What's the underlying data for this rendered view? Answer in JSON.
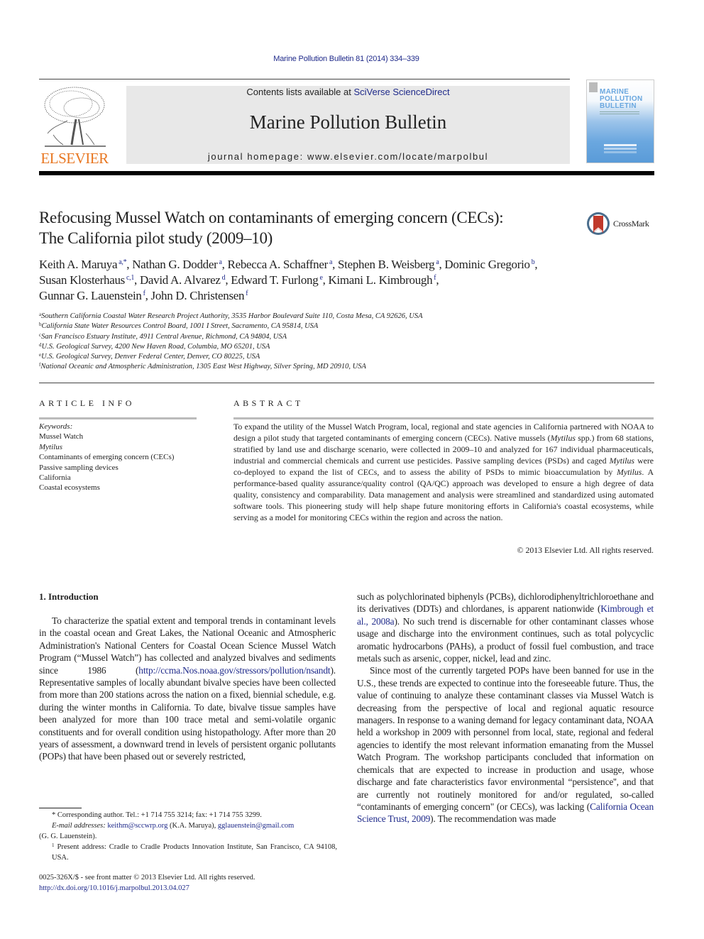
{
  "header": {
    "citation": "Marine Pollution Bulletin 81 (2014) 334–339",
    "contents_prefix": "Contents lists available at ",
    "contents_link": "SciVerse ScienceDirect",
    "journal_title": "Marine Pollution Bulletin",
    "homepage": "journal homepage: www.elsevier.com/locate/marpolbul",
    "publisher_logo_text": "ELSEVIER",
    "cover": {
      "title_lines": [
        "MARINE",
        "POLLUTION",
        "BULLETIN"
      ]
    },
    "crossmark_label": "CrossMark"
  },
  "article": {
    "title_line1": "Refocusing Mussel Watch on contaminants of emerging concern (CECs):",
    "title_line2": "The California pilot study (2009–10)",
    "authors": [
      {
        "name": "Keith A. Maruya",
        "sup": "a,*",
        "sep": ", "
      },
      {
        "name": "Nathan G. Dodder",
        "sup": "a",
        "sep": ", "
      },
      {
        "name": "Rebecca A. Schaffner",
        "sup": "a",
        "sep": ", "
      },
      {
        "name": "Stephen B. Weisberg",
        "sup": "a",
        "sep": ", "
      },
      {
        "name": "Dominic Gregorio",
        "sup": "b",
        "sep": ","
      },
      {
        "name": "Susan Klosterhaus",
        "sup": "c,1",
        "sep": ", "
      },
      {
        "name": "David A. Alvarez",
        "sup": "d",
        "sep": ", "
      },
      {
        "name": "Edward T. Furlong",
        "sup": "e",
        "sep": ", "
      },
      {
        "name": "Kimani L. Kimbrough",
        "sup": "f",
        "sep": ","
      },
      {
        "name": "Gunnar G. Lauenstein",
        "sup": "f",
        "sep": ", "
      },
      {
        "name": "John D. Christensen",
        "sup": "f",
        "sep": ""
      }
    ],
    "affiliations": [
      {
        "key": "a",
        "text": "Southern California Coastal Water Research Project Authority, 3535 Harbor Boulevard Suite 110, Costa Mesa, CA 92626, USA"
      },
      {
        "key": "b",
        "text": "California State Water Resources Control Board, 1001 I Street, Sacramento, CA 95814, USA"
      },
      {
        "key": "c",
        "text": "San Francisco Estuary Institute, 4911 Central Avenue, Richmond, CA 94804, USA"
      },
      {
        "key": "d",
        "text": "U.S. Geological Survey, 4200 New Haven Road, Columbia, MO 65201, USA"
      },
      {
        "key": "e",
        "text": "U.S. Geological Survey, Denver Federal Center, Denver, CO 80225, USA"
      },
      {
        "key": "f",
        "text": "National Oceanic and Atmospheric Administration, 1305 East West Highway, Silver Spring, MD 20910, USA"
      }
    ]
  },
  "article_info": {
    "heading": "ARTICLE INFO",
    "keywords_label": "Keywords:",
    "keywords": [
      "Mussel Watch",
      "Mytilus",
      "Contaminants of emerging concern (CECs)",
      "Passive sampling devices",
      "California",
      "Coastal ecosystems"
    ]
  },
  "abstract": {
    "heading": "ABSTRACT",
    "p1": "To expand the utility of the Mussel Watch Program, local, regional and state agencies in California partnered with NOAA to design a pilot study that targeted contaminants of emerging concern (CECs). Native mussels (",
    "p1_italic": "Mytilus",
    "p2": " spp.) from 68 stations, stratified by land use and discharge scenario, were collected in 2009–10 and analyzed for 167 individual pharmaceuticals, industrial and commercial chemicals and current use pesticides. Passive sampling devices (PSDs) and caged ",
    "p2_italic": "Mytilus",
    "p3": " were co-deployed to expand the list of CECs, and to assess the ability of PSDs to mimic bioaccumulation by ",
    "p3_italic": "Mytilus",
    "p4": ". A performance-based quality assurance/quality control (QA/QC) approach was developed to ensure a high degree of data quality, consistency and comparability. Data management and analysis were streamlined and standardized using automated software tools. This pioneering study will help shape future monitoring efforts in California's coastal ecosystems, while serving as a model for monitoring CECs within the region and across the nation.",
    "copyright": "© 2013 Elsevier Ltd. All rights reserved."
  },
  "introduction": {
    "heading": "1. Introduction",
    "left_p1_a": "To characterize the spatial extent and temporal trends in contaminant levels in the coastal ocean and Great Lakes, the National Oceanic and Atmospheric Administration's National Centers for Coastal Ocean Science Mussel Watch Program (“Mussel Watch”) has collected and analyzed bivalves and sediments since 1986 (",
    "left_p1_link": "http://ccma.Nos.noaa.gov/stressors/pollution/nsandt",
    "left_p1_b": ").  Representative samples of locally abundant bivalve species have been collected from more than 200 stations across the nation on a fixed, biennial schedule, e.g. during the winter months in California. To date, bivalve tissue samples have been analyzed for more than 100 trace metal and semi-volatile organic constituents and for overall condition using histopathology. After more than 20 years of assessment, a downward trend in levels of persistent organic pollutants (POPs) that have been phased out or severely restricted,",
    "right_p1_a": "such as polychlorinated biphenyls (PCBs), dichlorodiphenyltrichloroethane and its derivatives (DDTs) and chlordanes, is apparent nationwide (",
    "right_p1_link": "Kimbrough et al., 2008a",
    "right_p1_b": "). No such trend is discernable for other contaminant classes whose usage and discharge into the environment continues, such as total polycyclic aromatic hydrocarbons (PAHs), a product of fossil fuel combustion, and trace metals such as arsenic, copper, nickel, lead and zinc.",
    "right_p2_a": "Since most of the currently targeted POPs have been banned for use in the U.S., these trends are expected to continue into the foreseeable future. Thus, the value of continuing to analyze these contaminant classes via Mussel Watch is decreasing from the perspective of local and regional aquatic resource managers. In response to a waning demand for legacy contaminant data, NOAA held a workshop in 2009 with personnel from local, state, regional and federal agencies to identify the most relevant information emanating from the Mussel Watch Program. The workshop participants concluded that information on chemicals that are expected to increase in production and usage, whose discharge and fate characteristics favor environmental “persistence'', and that are currently not routinely monitored for and/or regulated, so-called “contaminants of emerging concern\" (or CECs), was lacking (",
    "right_p2_link": "California Ocean Science Trust, 2009",
    "right_p2_b": "). The recommendation was made"
  },
  "footnotes": {
    "corresponding": "* Corresponding author. Tel.: +1 714 755 3214; fax: +1 714 755 3299.",
    "email_label": "E-mail addresses:",
    "email1": "keithm@sccwrp.org",
    "email1_name": " (K.A. Maruya), ",
    "email2": "gglauenstein@gmail.com",
    "email2_name": "(G. G. Lauenstein).",
    "present_address_sup": "1",
    "present_address": "Present address: Cradle to Cradle Products Innovation Institute, San Francisco, CA 94108, USA."
  },
  "front_matter": {
    "issn": "0025-326X/$ - see front matter © 2013 Elsevier Ltd. All rights reserved.",
    "doi": "http://dx.doi.org/10.1016/j.marpolbul.2013.04.027"
  },
  "colors": {
    "link": "#1f2a8a",
    "elsevier_orange": "#e87722",
    "header_box": "#e8e8e8",
    "crossmark_red": "#c0392b"
  }
}
